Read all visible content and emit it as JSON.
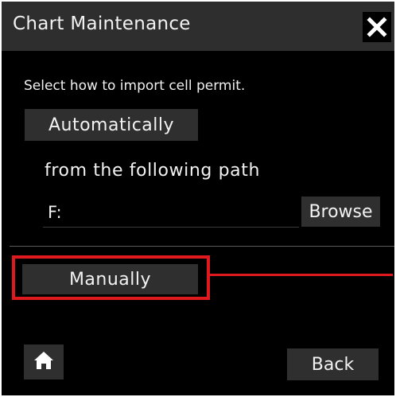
{
  "window": {
    "title": "Chart Maintenance",
    "close_icon": "close-icon"
  },
  "content": {
    "instruction": "Select how to import cell permit.",
    "automatic_button": "Automatically",
    "path_label": "from the following path",
    "path_value": "F:",
    "browse_button": "Browse",
    "manual_button": "Manually"
  },
  "footer": {
    "home_icon": "home-icon",
    "back_button": "Back"
  },
  "colors": {
    "background": "#000000",
    "titlebar": "#2e2e2e",
    "button": "#2f2f2f",
    "text": "#f2f2f2",
    "highlight": "#e0191e"
  }
}
